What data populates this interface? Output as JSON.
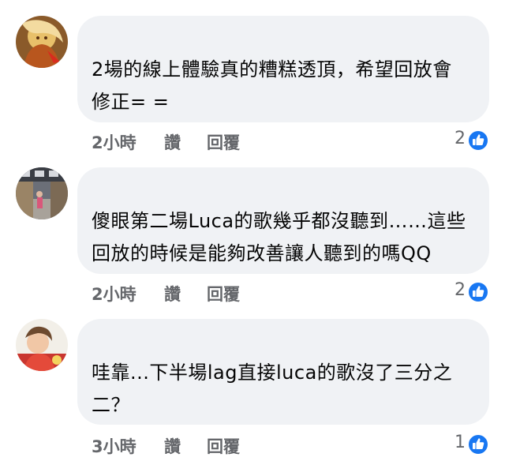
{
  "comments": [
    {
      "text": "2場的線上體驗真的糟糕透頂，希望回放會\n修正= =",
      "time": "2小時",
      "like_label": "讚",
      "reply_label": "回覆",
      "reaction_count": "2",
      "avatar_icon": "avatar-golden-character-icon"
    },
    {
      "text": "傻眼第二場Luca的歌幾乎都沒聽到……這些\n回放的時候是能夠改善讓人聽到的嗎QQ",
      "time": "2小時",
      "like_label": "讚",
      "reply_label": "回覆",
      "reaction_count": "2",
      "avatar_icon": "avatar-street-photo-icon"
    },
    {
      "text": "哇靠...下半場lag直接luca的歌沒了三分之\n二？",
      "time": "3小時",
      "like_label": "讚",
      "reply_label": "回覆",
      "reaction_count": "1",
      "avatar_icon": "avatar-person-photo-icon"
    }
  ],
  "colors": {
    "bubble": "#f0f2f5",
    "text": "#050505",
    "meta": "#65676b",
    "like_blue": "#1877f2"
  }
}
